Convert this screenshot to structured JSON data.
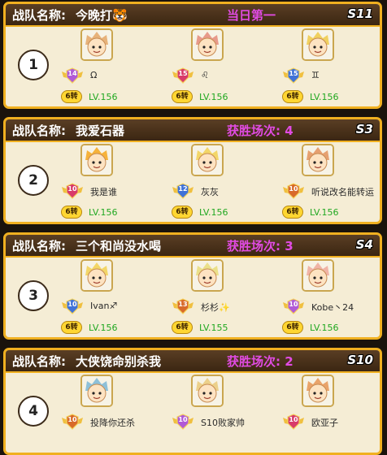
{
  "label": "战队名称:",
  "teams": [
    {
      "rank": "1",
      "name": "今晚打🐯",
      "result": "当日第一",
      "server": "S11",
      "members": [
        {
          "medal": "14",
          "name": "Ω",
          "badge": "6转",
          "level": "LV.156",
          "hair": "#e7b27a"
        },
        {
          "medal": "15",
          "name": "♌",
          "badge": "6转",
          "level": "LV.156",
          "hair": "#e79a8a"
        },
        {
          "medal": "15",
          "name": "♊",
          "badge": "6转",
          "level": "LV.156",
          "hair": "#f0d060"
        }
      ]
    },
    {
      "rank": "2",
      "name": "我爱石器",
      "result": "获胜场次: 4",
      "server": "S3",
      "members": [
        {
          "medal": "10",
          "name": "我是谁",
          "badge": "6转",
          "level": "LV.156",
          "hair": "#f6b23a"
        },
        {
          "medal": "12",
          "name": "灰灰",
          "badge": "6转",
          "level": "LV.156",
          "hair": "#f3d668"
        },
        {
          "medal": "10",
          "name": "听说改名能转运",
          "badge": "6转",
          "level": "LV.156",
          "hair": "#e6a070"
        }
      ]
    },
    {
      "rank": "3",
      "name": "三个和尚没水喝",
      "result": "获胜场次: 3",
      "server": "S4",
      "members": [
        {
          "medal": "10",
          "name": "Ivan♐",
          "badge": "6转",
          "level": "LV.156",
          "hair": "#f3d668"
        },
        {
          "medal": "13",
          "name": "杉杉✨",
          "badge": "6转",
          "level": "LV.155",
          "hair": "#ebe08a"
        },
        {
          "medal": "10",
          "name": "Kobe丶24",
          "badge": "6转",
          "level": "LV.156",
          "hair": "#f0b4a6"
        }
      ]
    },
    {
      "rank": "4",
      "name": "大侠饶命别杀我",
      "result": "获胜场次: 2",
      "server": "S10",
      "members": [
        {
          "medal": "10",
          "name": "投降你还杀",
          "badge": "",
          "level": "",
          "hair": "#8ec0d8"
        },
        {
          "medal": "10",
          "name": "S10败家帅",
          "badge": "",
          "level": "",
          "hair": "#ecd08a"
        },
        {
          "medal": "10",
          "name": "欧亚子",
          "badge": "",
          "level": "",
          "hair": "#e9a36a"
        }
      ]
    }
  ]
}
